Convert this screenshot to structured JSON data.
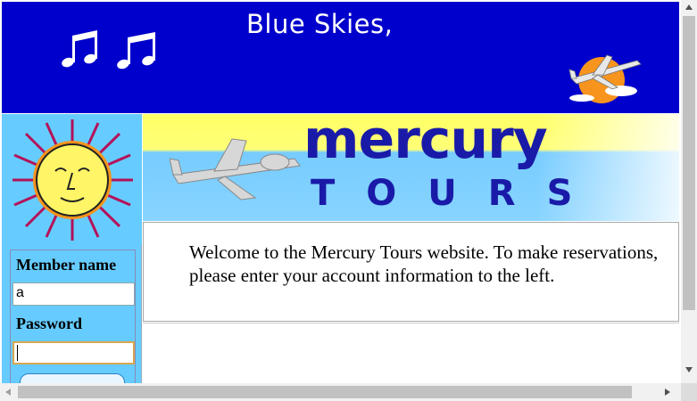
{
  "banner": {
    "title": "Blue Skies,",
    "background": "#0000cc",
    "icons": [
      "music-notes-icon",
      "sun-with-airplane-icon"
    ]
  },
  "sidebar": {
    "background": "#66ccff",
    "sun_icon": "sun-face-icon",
    "member_label": "Member name",
    "username_value": "a",
    "password_label": "Password",
    "password_value": ""
  },
  "logo": {
    "word1": "mercury",
    "word2": "TOURS",
    "airplane_icon": "airplane-icon"
  },
  "content": {
    "welcome": "Welcome to the Mercury Tours website. To make reservations, please enter your account information to the left."
  }
}
